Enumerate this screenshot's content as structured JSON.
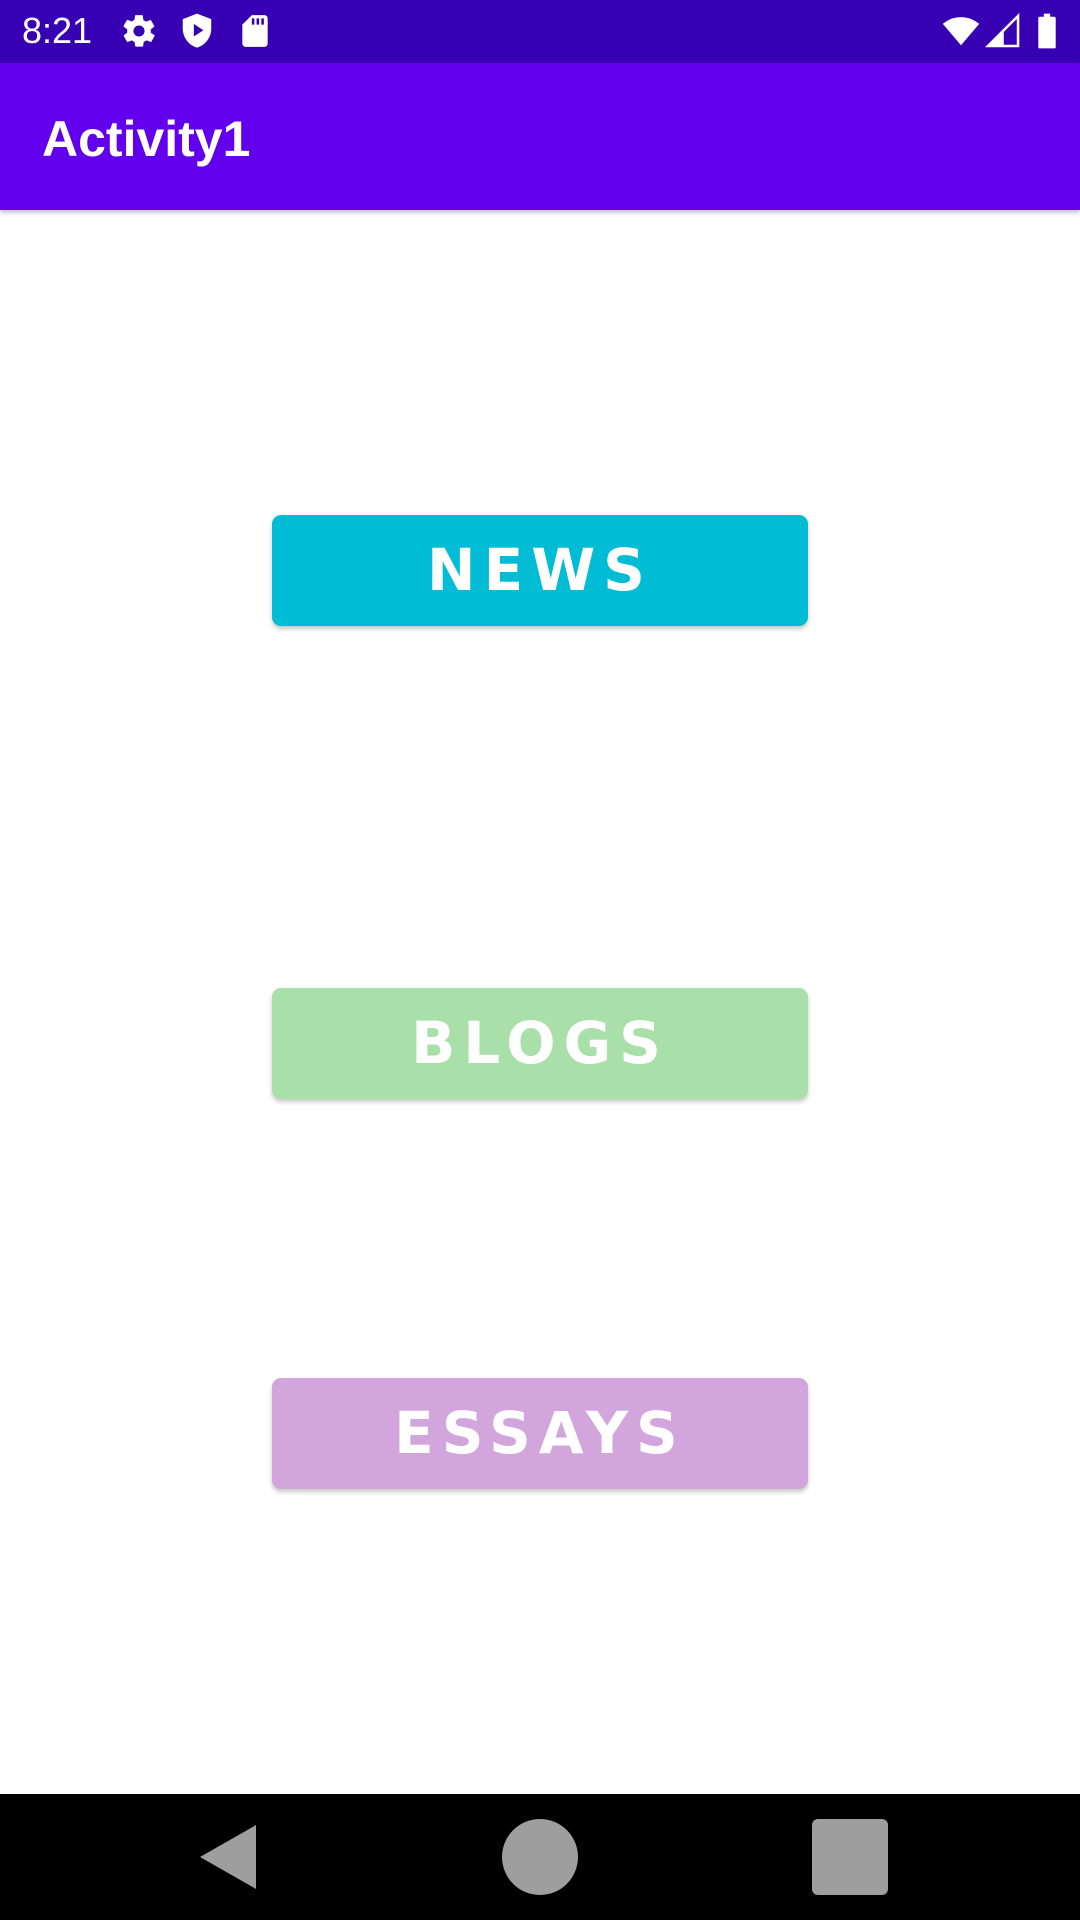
{
  "status_bar": {
    "time": "8:21",
    "background": "#3700b3",
    "left_icons": [
      "settings-gear-icon",
      "shield-play-icon",
      "sd-card-icon"
    ],
    "right_icons": [
      "wifi-icon",
      "cell-signal-icon",
      "battery-icon"
    ]
  },
  "app_bar": {
    "title": "Activity1",
    "background": "#6200ee"
  },
  "buttons": {
    "news": {
      "label": "NEWS",
      "color": "#00bcd4"
    },
    "blogs": {
      "label": "BLOGS",
      "color": "#a9dfa9"
    },
    "essays": {
      "label": "ESSAYS",
      "color": "#d2a6dc"
    }
  },
  "nav_bar": {
    "icons": [
      "back-icon",
      "home-icon",
      "recents-icon"
    ],
    "icon_color": "#9e9e9e"
  }
}
